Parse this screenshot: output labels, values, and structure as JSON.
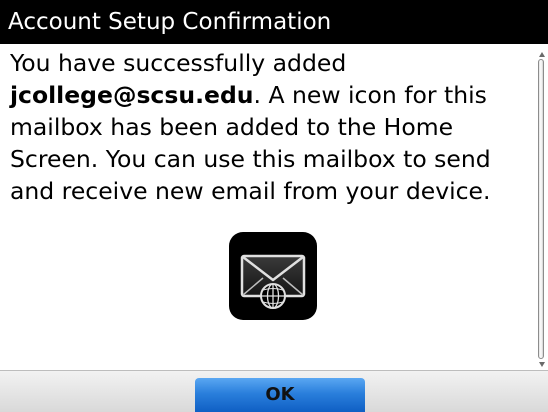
{
  "dialog": {
    "title": "Account Setup Confirmation",
    "message_before": "You have successfully added ",
    "email": "jcollege@scsu.edu",
    "message_after": ". A new icon for this mailbox has been added to the Home Screen. You can use this mailbox to send and receive new email from your device.",
    "icon": "mailbox-globe-icon",
    "ok_label": "OK"
  },
  "colors": {
    "title_bar_bg": "#000000",
    "button_accent": "#2a7fdc"
  }
}
